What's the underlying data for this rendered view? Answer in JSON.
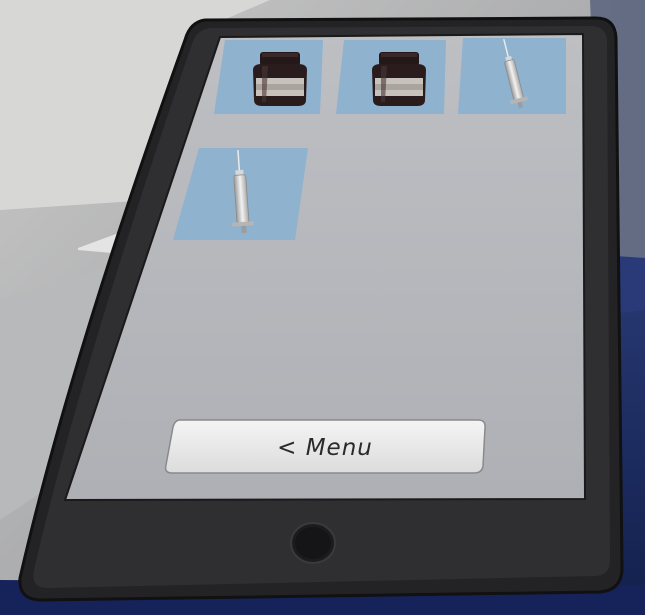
{
  "inventory": {
    "slots": [
      {
        "item": "medicine-jar",
        "icon": "medicine-jar-icon"
      },
      {
        "item": "medicine-jar",
        "icon": "medicine-jar-icon"
      },
      {
        "item": "syringe",
        "icon": "syringe-icon"
      },
      {
        "item": "syringe",
        "icon": "syringe-icon"
      }
    ]
  },
  "menu_button": {
    "label": "< Menu"
  },
  "colors": {
    "slot_bg": "#8fb2cf",
    "screen_bg": "#b6b8bc",
    "tablet_frame": "#2b2b2d",
    "floor": "#1b2a5e",
    "wall": "#9ea0a4"
  }
}
